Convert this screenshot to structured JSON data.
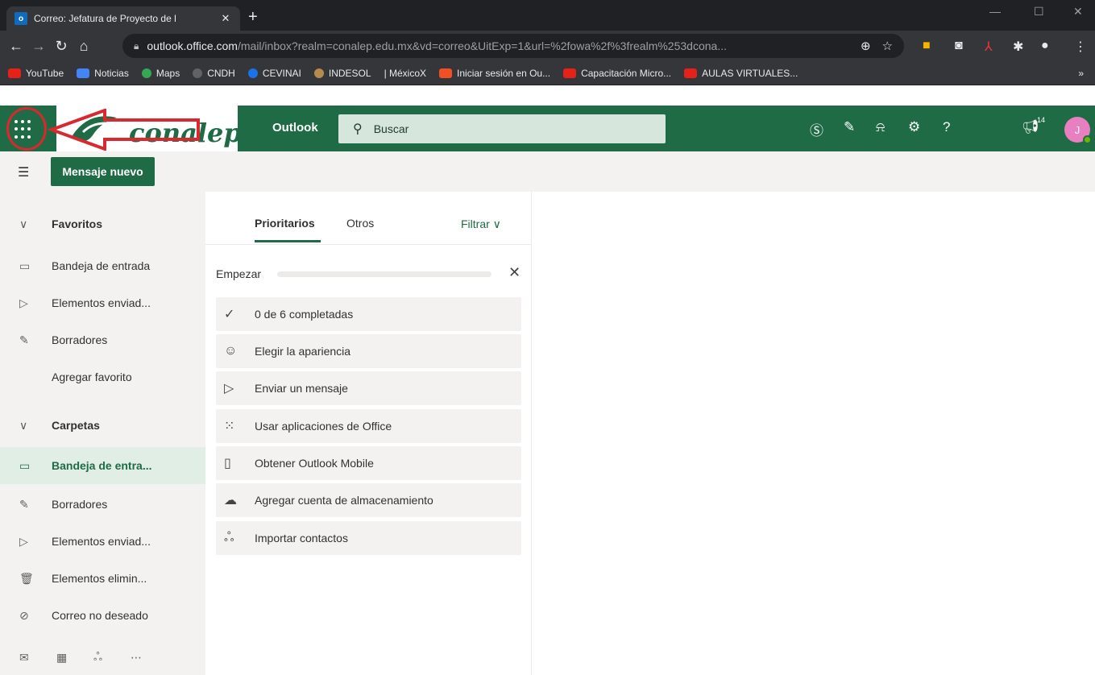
{
  "browser": {
    "tab_title": "Correo: Jefatura de Proyecto de l",
    "tab_favicon": "o",
    "newtab": "+",
    "url_host": "outlook.office.com",
    "url_path": "/mail/inbox?realm=conalep.edu.mx&vd=correo&UitExp=1&url=%2fowa%2f%3frealm%253dcona...",
    "bookmarks": [
      "YouTube",
      "Noticias",
      "Maps",
      "CNDH",
      "CEVINAI",
      "INDESOL",
      "| MéxicoX",
      "Iniciar sesión en Ou...",
      "Capacitación Micro...",
      "AULAS VIRTUALES..."
    ],
    "bookmarks_more": "»"
  },
  "header": {
    "logo_text": "conalep",
    "app_name": "Outlook",
    "search_placeholder": "Buscar",
    "notifications_badge": "14",
    "avatar_initial": "J"
  },
  "command_bar": {
    "new_message": "Mensaje nuevo"
  },
  "sidebar": {
    "favorites_header": "Favoritos",
    "favorites": [
      {
        "label": "Bandeja de entrada",
        "icon": "inbox-icon"
      },
      {
        "label": "Elementos enviad...",
        "icon": "send-icon"
      },
      {
        "label": "Borradores",
        "icon": "pencil-icon"
      }
    ],
    "add_favorite": "Agregar favorito",
    "folders_header": "Carpetas",
    "folders": [
      {
        "label": "Bandeja de entra...",
        "icon": "inbox-icon",
        "selected": true
      },
      {
        "label": "Borradores",
        "icon": "pencil-icon"
      },
      {
        "label": "Elementos enviad...",
        "icon": "send-icon"
      },
      {
        "label": "Elementos elimin...",
        "icon": "trash-icon"
      },
      {
        "label": "Correo no deseado",
        "icon": "blocked-icon"
      }
    ]
  },
  "message_list": {
    "tab_focused": "Prioritarios",
    "tab_other": "Otros",
    "filter": "Filtrar",
    "getting_started": "Empezar",
    "progress_fraction": 0,
    "tasks": [
      {
        "label": "0 de 6 completadas",
        "icon": "check-icon"
      },
      {
        "label": "Elegir la apariencia",
        "icon": "palette-icon"
      },
      {
        "label": "Enviar un mensaje",
        "icon": "send-icon"
      },
      {
        "label": "Usar aplicaciones de Office",
        "icon": "apps-icon"
      },
      {
        "label": "Obtener Outlook Mobile",
        "icon": "phone-icon"
      },
      {
        "label": "Agregar cuenta de almacenamiento",
        "icon": "cloud-add-icon"
      },
      {
        "label": "Importar contactos",
        "icon": "people-icon"
      }
    ]
  },
  "colors": {
    "brand_green": "#1e6b45",
    "annotation_red": "#d9282f"
  }
}
